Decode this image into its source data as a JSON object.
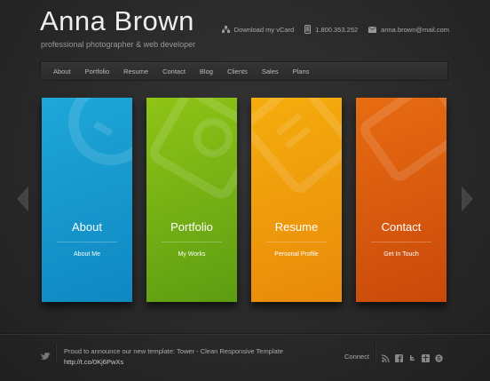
{
  "header": {
    "title": "Anna Brown",
    "subtitle": "professional photographer & web developer",
    "vcard_label": "Download my vCard",
    "phone": "1.800.353.252",
    "email": "anna.brown@mail.com"
  },
  "nav": {
    "items": [
      "About",
      "Portfolio",
      "Resume",
      "Contact",
      "Blog",
      "Clients",
      "Sales",
      "Plans"
    ]
  },
  "tiles": [
    {
      "title": "About",
      "subtitle": "About Me",
      "color_top": "#1ea7d8",
      "color_bottom": "#0f88c2"
    },
    {
      "title": "Portfolio",
      "subtitle": "My Works",
      "color_top": "#8fc416",
      "color_bottom": "#5c9d12"
    },
    {
      "title": "Resume",
      "subtitle": "Personal Profile",
      "color_top": "#f5ad0d",
      "color_bottom": "#e98a0a"
    },
    {
      "title": "Contact",
      "subtitle": "Get In Touch",
      "color_top": "#e86c12",
      "color_bottom": "#c9490a"
    }
  ],
  "footer": {
    "news_text": "Proud to announce our new template: Tower - Clean Responsive Template",
    "news_link": "http://t.co/0Kj6PwXs",
    "connect_label": "Connect",
    "social_icons": [
      "rss-icon",
      "facebook-icon",
      "twitter-icon",
      "flickr-icon",
      "skype-icon"
    ]
  },
  "colors": {
    "background": "#2a2a2a",
    "nav_bg": "#303030"
  }
}
